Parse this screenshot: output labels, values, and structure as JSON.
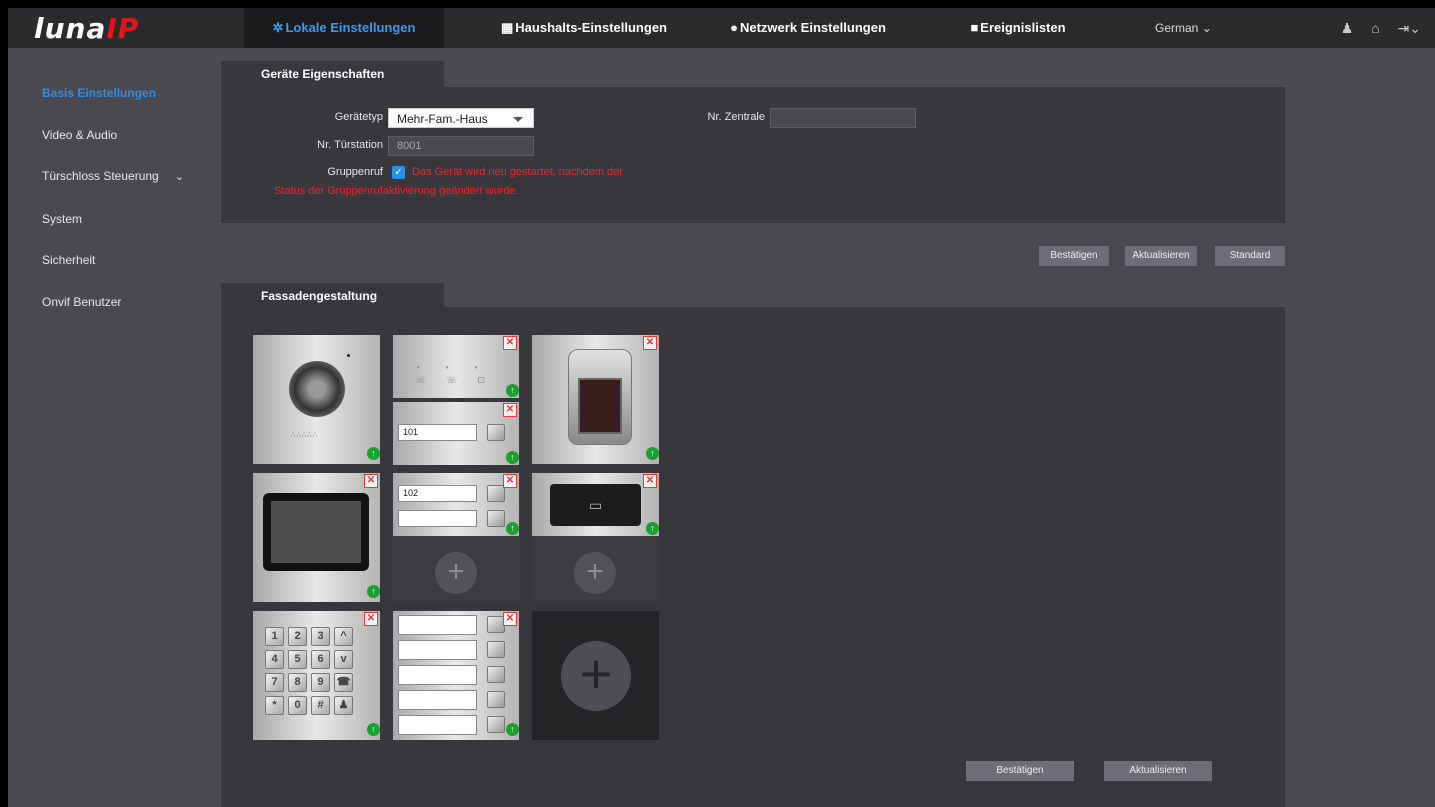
{
  "brand": {
    "logo_main": "luna",
    "logo_accent": "IP"
  },
  "nav": {
    "tabs": [
      {
        "label": "Lokale Einstellungen",
        "icon": "gear-icon"
      },
      {
        "label": "Haushalts-Einstellungen",
        "icon": "building-icon"
      },
      {
        "label": "Netzwerk Einstellungen",
        "icon": "globe-icon"
      },
      {
        "label": "Ereignislisten",
        "icon": "list-icon"
      }
    ],
    "language": "German",
    "icons": [
      "user-icon",
      "home-icon",
      "logout-icon"
    ]
  },
  "sidebar": {
    "items": [
      {
        "label": "Basis Einstellungen"
      },
      {
        "label": "Video & Audio"
      },
      {
        "label": "Türschloss Steuerung"
      },
      {
        "label": "System"
      },
      {
        "label": "Sicherheit"
      },
      {
        "label": "Onvif Benutzer"
      }
    ]
  },
  "device": {
    "section_title": "Geräte Eigenschaften",
    "type_label": "Gerätetyp",
    "type_value": "Mehr-Fam.-Haus",
    "station_label": "Nr. Türstation",
    "station_value": "8001",
    "central_label": "Nr. Zentrale",
    "central_value": "",
    "group_label": "Gruppenruf",
    "group_checked": true,
    "group_warning_line1": "Das Gerät wird neu gestartet, nachdem der",
    "group_warning_line2": "Status der Gruppenrufaktivierung geändert wurde.",
    "btn_confirm": "Bestätigen",
    "btn_refresh": "Aktualisieren",
    "btn_default": "Standard"
  },
  "facade": {
    "section_title": "Fassadengestaltung",
    "nameplates": [
      "101",
      "102"
    ],
    "keypad_keys": [
      "1",
      "2",
      "3",
      "^",
      "4",
      "5",
      "6",
      "v",
      "7",
      "8",
      "9",
      "☎",
      "*",
      "0",
      "#",
      "♟"
    ],
    "btn_confirm": "Bestätigen",
    "btn_refresh": "Aktualisieren"
  },
  "colors": {
    "accent": "#2e8fe6",
    "warning": "#e8272d",
    "brand_red": "#e2161a"
  }
}
